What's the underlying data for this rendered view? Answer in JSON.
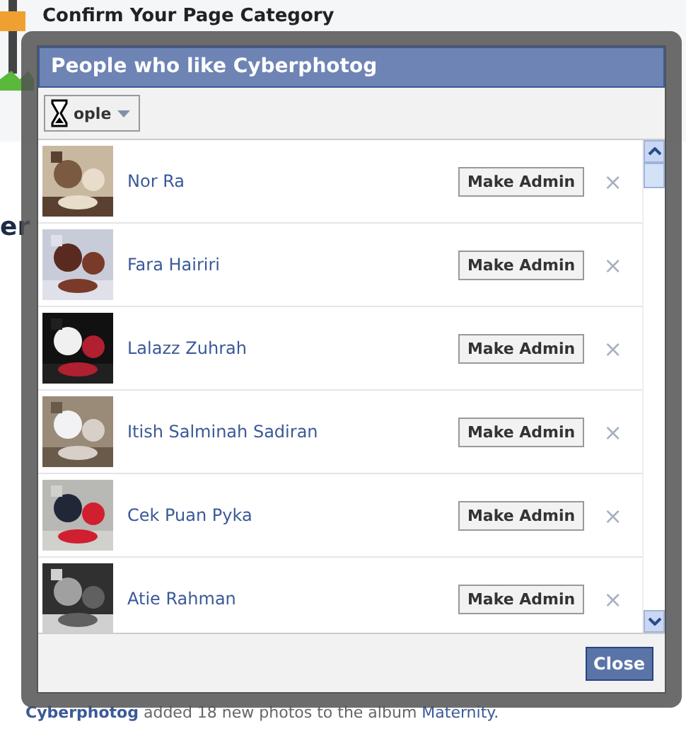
{
  "page": {
    "heading": "Confirm Your Page Category",
    "fragment": "er",
    "story": {
      "actor": "Cyberphotog",
      "text": "added 18 new photos to the album",
      "album": "Maternity."
    }
  },
  "dialog": {
    "title": "People who like Cyberphotog",
    "filter": "ople",
    "people": [
      {
        "name": "Nor Ra",
        "action": "Make Admin",
        "remove": "×"
      },
      {
        "name": "Fara Hairiri",
        "action": "Make Admin",
        "remove": "×"
      },
      {
        "name": "Lalazz Zuhrah",
        "action": "Make Admin",
        "remove": "×"
      },
      {
        "name": "Itish Salminah Sadiran",
        "action": "Make Admin",
        "remove": "×"
      },
      {
        "name": "Cek Puan Pyka",
        "action": "Make Admin",
        "remove": "×"
      },
      {
        "name": "Atie Rahman",
        "action": "Make Admin",
        "remove": "×"
      }
    ],
    "close": "Close"
  }
}
